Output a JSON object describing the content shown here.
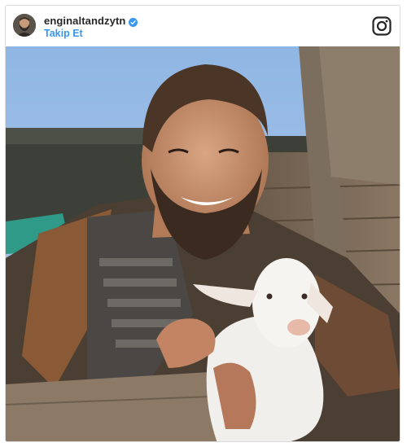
{
  "post": {
    "username": "enginaltandzytn",
    "follow_label": "Takip Et",
    "verified": true
  },
  "icons": {
    "avatar": "profile-avatar",
    "verified": "verified-badge-icon",
    "brand": "instagram-icon"
  },
  "colors": {
    "follow_link": "#3897f0",
    "verified_badge": "#3897f0",
    "border": "#dbdbdb",
    "username": "#262626"
  }
}
